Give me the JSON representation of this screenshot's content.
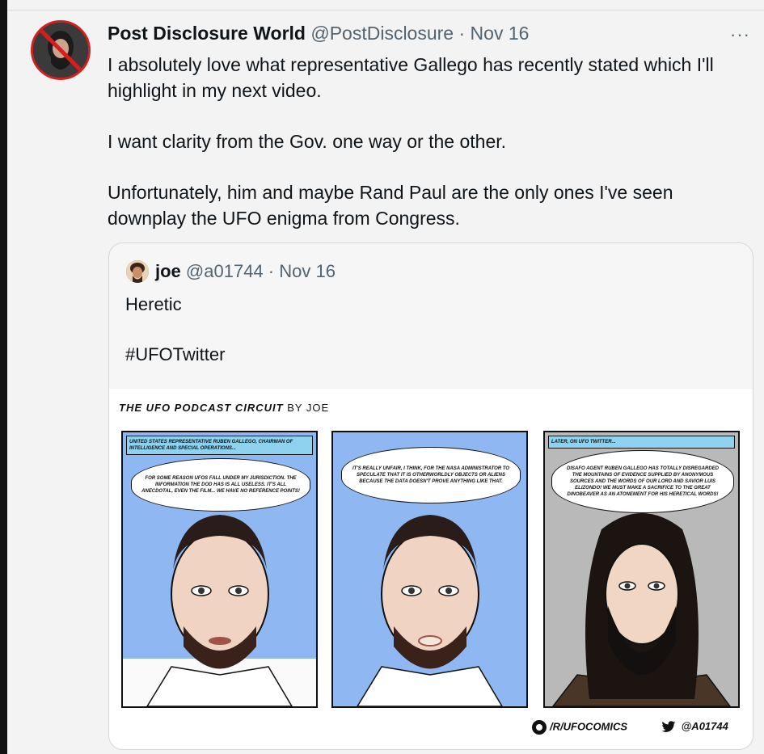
{
  "tweet": {
    "author_name": "Post Disclosure World",
    "author_handle": "@PostDisclosure",
    "separator": "·",
    "date": "Nov 16",
    "more_icon": "···",
    "paragraphs": [
      "I absolutely love what representative Gallego has recently stated which I'll highlight in my next video.",
      "I want clarity from the Gov. one way or the other.",
      "Unfortunately, him and maybe Rand Paul are the only ones I've seen downplay the UFO enigma from Congress."
    ]
  },
  "quoted_tweet": {
    "author_name": "joe",
    "author_handle": "@a01744",
    "separator": "·",
    "date": "Nov 16",
    "paragraphs": [
      "Heretic",
      "#UFOTwitter"
    ]
  },
  "comic": {
    "title": "THE UFO PODCAST CIRCUIT",
    "title_by": "BY JOE",
    "panels": [
      {
        "caption": "UNITED STATES REPRESENTATIVE RUBEN GALLEGO, CHAIRMAN OF INTELLIGENCE AND SPECIAL OPERATIONS...",
        "bubble": "FOR SOME REASON UFOS FALL UNDER MY JURISDICTION. THE INFORMATION THE DOD HAS IS ALL USELESS. IT'S ALL ANECDOTAL, EVEN THE FILM... WE HAVE NO REFERENCE POINTS!"
      },
      {
        "caption": "",
        "bubble": "IT'S REALLY UNFAIR, I THINK, FOR THE NASA ADMINISTRATOR TO SPECULATE THAT IT IS OTHERWORLDLY OBJECTS OR ALIENS BECAUSE THE DATA DOESN'T PROVE ANYTHING LIKE THAT."
      },
      {
        "caption": "LATER, ON UFO TWITTER...",
        "bubble": "DISAFO AGENT RUBEN GALLEGO HAS TOTALLY DISREGARDED THE MOUNTAINS OF EVIDENCE SUPPLIED BY ANONYMOUS SOURCES AND THE WORDS OF OUR LORD AND SAVIOR LUIS ELIZONDO! WE MUST MAKE A SACRIFICE TO THE GREAT DINOBEAVER AS AN ATONEMENT FOR HIS HERETICAL WORDS!"
      }
    ],
    "credit_reddit": "/R/UFOCOMICS",
    "credit_twitter": "@A01744"
  },
  "colors": {
    "panel_blue": "#8fb8f2",
    "panel_gray": "#b9b9b9",
    "caption_blue": "#8fd2ef"
  }
}
